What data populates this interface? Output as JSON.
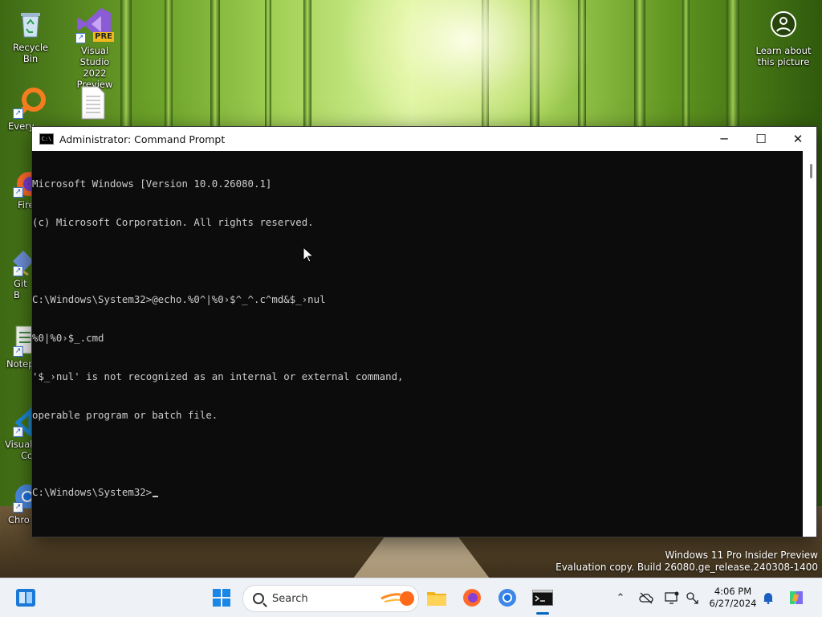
{
  "desktop": {
    "icons": [
      {
        "label": "Recycle Bin",
        "icon": "recycle-bin-icon"
      },
      {
        "label": "Visual Studio 2022 Preview",
        "line1": "Visual Studio",
        "line2": "2022 Preview",
        "badge": "PRE",
        "icon": "visual-studio-icon"
      },
      {
        "label": "Every",
        "icon": "everything-search-icon"
      },
      {
        "label": "",
        "icon": "text-file-icon"
      },
      {
        "label": "Fire",
        "icon": "firefox-icon"
      },
      {
        "label": "Git B",
        "icon": "git-bash-icon"
      },
      {
        "label": "Notep",
        "icon": "notepad-icon"
      },
      {
        "label": "Visual Co",
        "line1": "Visual",
        "line2": "Co",
        "icon": "vscode-icon"
      },
      {
        "label": "Chro",
        "icon": "chrome-icon"
      }
    ],
    "learn_about": {
      "line1": "Learn about",
      "line2": "this picture"
    }
  },
  "window": {
    "title": "Administrator: Command Prompt",
    "controls": {
      "minimize": "─",
      "maximize": "☐",
      "close": "✕"
    },
    "console_lines": [
      "Microsoft Windows [Version 10.0.26080.1]",
      "(c) Microsoft Corporation. All rights reserved.",
      "",
      "C:\\Windows\\System32>@echo.%0^|%0›$^_^.c^md&$_›nul",
      "%0|%0›$_.cmd",
      "'$_›nul' is not recognized as an internal or external command,",
      "operable program or batch file.",
      ""
    ],
    "prompt": "C:\\Windows\\System32>"
  },
  "watermark": {
    "line1": "Windows 11 Pro Insider Preview",
    "line2": "Evaluation copy. Build 26080.ge_release.240308-1400"
  },
  "taskbar": {
    "search_label": "Search",
    "apps": [
      "start-icon",
      "file-explorer-icon",
      "firefox-icon",
      "chrome-icon",
      "command-prompt-icon"
    ],
    "clock": {
      "time": "4:06 PM",
      "date": "6/27/2024"
    }
  },
  "colors": {
    "console_bg": "#0c0c0c",
    "console_fg": "#cccccc",
    "taskbar_bg": "#eef1f6",
    "accent": "#0067c0"
  }
}
